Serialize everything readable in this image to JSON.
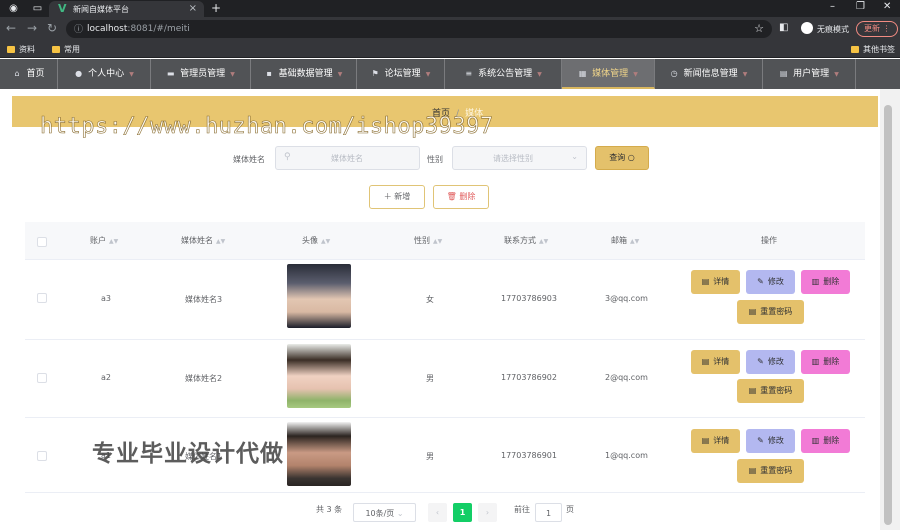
{
  "browser": {
    "tab_title": "新闻自媒体平台",
    "url_host": "localhost",
    "url_rest": ":8081/#/meiti",
    "profile_label": "无痕模式",
    "update_label": "更新",
    "bookmarks": [
      "资料",
      "常用"
    ],
    "other_bookmarks": "其他书签"
  },
  "menu": [
    {
      "label": "首页",
      "icon": "home-icon"
    },
    {
      "label": "个人中心",
      "icon": "user-icon"
    },
    {
      "label": "管理员管理",
      "icon": "admin-icon"
    },
    {
      "label": "基础数据管理",
      "icon": "chat-icon"
    },
    {
      "label": "论坛管理",
      "icon": "flag-icon"
    },
    {
      "label": "系统公告管理",
      "icon": "list-icon"
    },
    {
      "label": "媒体管理",
      "icon": "calendar-icon"
    },
    {
      "label": "新闻信息管理",
      "icon": "clock-icon"
    },
    {
      "label": "用户管理",
      "icon": "doc-icon"
    }
  ],
  "breadcrumb": {
    "home": "首页",
    "sep": "/",
    "current": "媒体"
  },
  "watermark_url": "https://www.huzhan.com/ishop39397",
  "search": {
    "name_label": "媒体姓名",
    "name_placeholder": "媒体姓名",
    "gender_label": "性别",
    "gender_placeholder": "请选择性别",
    "query_label": "查询"
  },
  "actions": {
    "add_label": "新增",
    "delete_label": "删除"
  },
  "table": {
    "columns": [
      "账户",
      "媒体姓名",
      "头像",
      "性别",
      "联系方式",
      "邮箱",
      "操作"
    ],
    "rows": [
      {
        "account": "a3",
        "name": "媒体姓名3",
        "gender": "女",
        "phone": "17703786903",
        "email": "3@qq.com"
      },
      {
        "account": "a2",
        "name": "媒体姓名2",
        "gender": "男",
        "phone": "17703786902",
        "email": "2@qq.com"
      },
      {
        "account": "a1",
        "name": "媒体姓名1",
        "gender": "男",
        "phone": "17703786901",
        "email": "1@qq.com"
      }
    ],
    "row_buttons": {
      "detail": "详情",
      "edit": "修改",
      "remove": "删除",
      "reset": "重置密码"
    }
  },
  "overlay_text": "专业毕业设计代做",
  "pagination": {
    "total": "共 3 条",
    "page_size": "10条/页",
    "current_page": "1",
    "goto_label": "前往",
    "goto_value": "1",
    "page_unit": "页"
  },
  "colors": {
    "accent": "#e4c16b",
    "menu_bg": "#515356",
    "page_active": "#13ce66"
  }
}
